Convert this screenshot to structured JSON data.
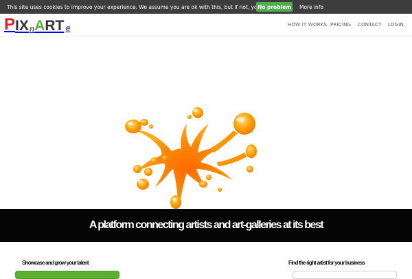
{
  "cookie_bar": {
    "message": "This site uses cookies to improve your experience. We assume you are ok with this, but if not, you can opt-out.",
    "accept_label": "No problem",
    "more_label": "More info"
  },
  "header": {
    "logo": {
      "p": "P",
      "ix": "IX",
      "n": "n",
      "a": "A",
      "rt": "RT",
      "e": "e"
    },
    "nav": [
      {
        "label": "HOW IT WORKS"
      },
      {
        "label": "PRICING"
      },
      {
        "label": "CONTACT"
      },
      {
        "label": "LOGIN"
      }
    ]
  },
  "hero": {
    "tagline": "A platform connecting artists and art-galleries at its best"
  },
  "sections": {
    "left_label": "Showcase and grow your talent",
    "right_label": "Find the right artist for your business"
  },
  "colors": {
    "cookie_bg": "#3d3d3d",
    "accept_green": "#4cae4c",
    "logo_red": "#d9262c",
    "logo_green": "#5ab031",
    "logo_orange": "#f5a000",
    "splash_orange": "#ff8a00",
    "banner_bg": "#050505"
  }
}
